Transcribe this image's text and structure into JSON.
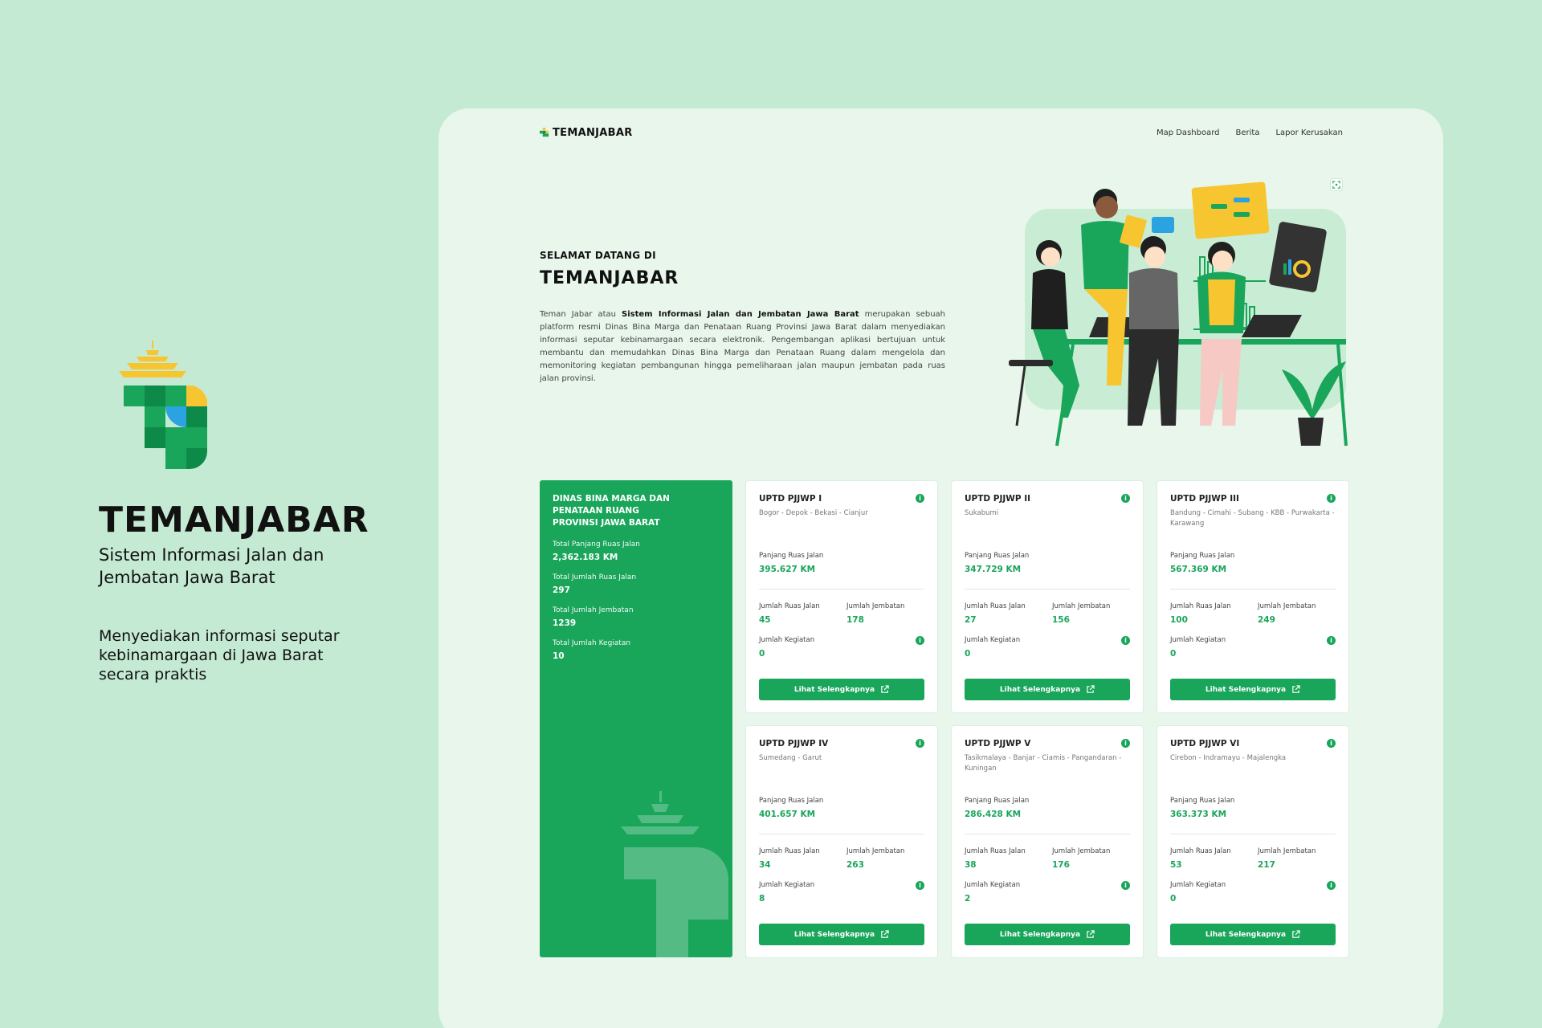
{
  "brand": {
    "title": "TEMANJABAR",
    "subtitle": "Sistem Informasi Jalan dan Jembatan Jawa Barat",
    "description": "Menyediakan informasi seputar kebinamargaan di Jawa Barat secara praktis"
  },
  "nav": {
    "logo_text": "TEMANJABAR",
    "links": [
      "Map Dashboard",
      "Berita",
      "Lapor Kerusakan"
    ]
  },
  "hero": {
    "kicker": "SELAMAT DATANG DI",
    "title": "TEMANJABAR",
    "body_prefix": "Teman Jabar atau ",
    "body_bold": "Sistem Informasi Jalan dan Jembatan Jawa Barat",
    "body_suffix": " merupakan sebuah platform resmi Dinas Bina Marga dan Penataan Ruang Provinsi Jawa Barat dalam menyediakan informasi seputar kebinamargaan secara elektronik. Pengembangan aplikasi bertujuan untuk membantu dan memudahkan Dinas Bina Marga dan Penataan Ruang dalam mengelola dan memonitoring kegiatan pembangunan hingga pemeliharaan jalan maupun jembatan pada ruas jalan provinsi."
  },
  "summary": {
    "title": "DINAS BINA MARGA DAN PENATAAN RUANG PROVINSI JAWA BARAT",
    "stats": [
      {
        "label": "Total Panjang Ruas Jalan",
        "value": "2,362.183 KM"
      },
      {
        "label": "Total Jumlah Ruas Jalan",
        "value": "297"
      },
      {
        "label": "Total Jumlah Jembatan",
        "value": "1239"
      },
      {
        "label": "Total Jumlah Kegiatan",
        "value": "10"
      }
    ]
  },
  "card_labels": {
    "panjang": "Panjang Ruas Jalan",
    "ruas": "Jumlah Ruas Jalan",
    "jembatan": "Jumlah Jembatan",
    "kegiatan": "Jumlah Kegiatan",
    "button": "Lihat Selengkapnya",
    "info": "i"
  },
  "cards": [
    {
      "title": "UPTD PJJWP I",
      "area": "Bogor - Depok - Bekasi - Cianjur",
      "panjang": "395.627 KM",
      "ruas": "45",
      "jembatan": "178",
      "kegiatan": "0"
    },
    {
      "title": "UPTD PJJWP II",
      "area": "Sukabumi",
      "panjang": "347.729 KM",
      "ruas": "27",
      "jembatan": "156",
      "kegiatan": "0"
    },
    {
      "title": "UPTD PJJWP III",
      "area": "Bandung - Cimahi - Subang - KBB - Purwakarta - Karawang",
      "panjang": "567.369 KM",
      "ruas": "100",
      "jembatan": "249",
      "kegiatan": "0"
    },
    {
      "title": "UPTD PJJWP IV",
      "area": "Sumedang - Garut",
      "panjang": "401.657 KM",
      "ruas": "34",
      "jembatan": "263",
      "kegiatan": "8"
    },
    {
      "title": "UPTD PJJWP V",
      "area": "Tasikmalaya - Banjar - Ciamis - Pangandaran - Kuningan",
      "panjang": "286.428 KM",
      "ruas": "38",
      "jembatan": "176",
      "kegiatan": "2"
    },
    {
      "title": "UPTD PJJWP VI",
      "area": "Cirebon - Indramayu - Majalengka",
      "panjang": "363.373 KM",
      "ruas": "53",
      "jembatan": "217",
      "kegiatan": "0"
    }
  ],
  "colors": {
    "page_bg": "#c5ead3",
    "screen_bg": "#e8f6ec",
    "primary_green": "#19a55a",
    "accent_yellow": "#f7c52f",
    "accent_blue": "#2ba3e0"
  }
}
